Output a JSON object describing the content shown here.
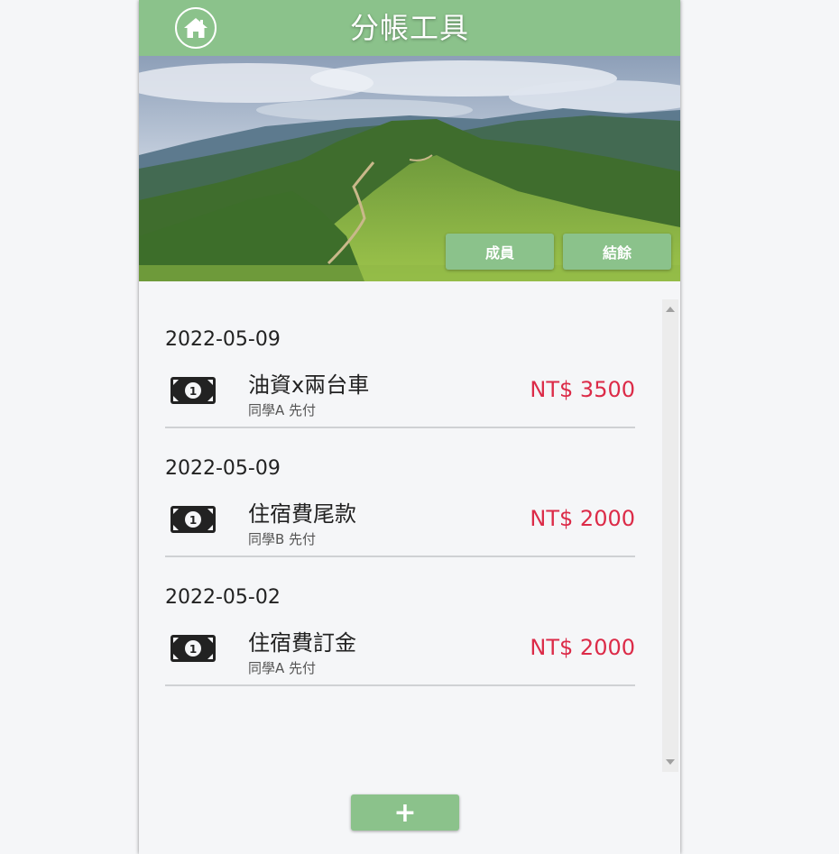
{
  "header": {
    "title": "分帳工具",
    "home_icon": "home-icon"
  },
  "hero": {
    "image": "mountain-landscape",
    "members_label": "成員",
    "balance_label": "結餘"
  },
  "entries": [
    {
      "date": "2022-05-09",
      "icon": "money-bill-icon",
      "name": "油資x兩台車",
      "payer": "同學A 先付",
      "amount": "NT$ 3500"
    },
    {
      "date": "2022-05-09",
      "icon": "money-bill-icon",
      "name": "住宿費尾款",
      "payer": "同學B 先付",
      "amount": "NT$ 2000"
    },
    {
      "date": "2022-05-02",
      "icon": "money-bill-icon",
      "name": "住宿費訂金",
      "payer": "同學A 先付",
      "amount": "NT$ 2000"
    }
  ],
  "add_button": {
    "label": "+"
  },
  "colors": {
    "accent": "#8bc28b",
    "amount": "#dc2b48",
    "background": "#f5f6f8"
  }
}
